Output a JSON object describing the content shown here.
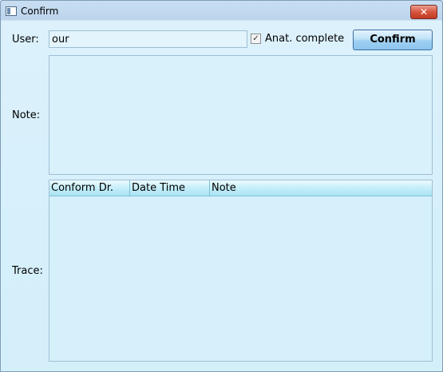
{
  "window": {
    "title": "Confirm",
    "close_glyph": "✕"
  },
  "form": {
    "user_label": "User:",
    "user_value": "our",
    "anat_complete_label": "Anat. complete",
    "anat_complete_checked": true,
    "confirm_button": "Confirm",
    "note_label": "Note:",
    "note_value": "",
    "trace_label": "Trace:"
  },
  "trace": {
    "columns": [
      "Conform Dr.",
      "Date  Time",
      "Note"
    ],
    "rows": []
  },
  "icons": {
    "app": "window-app-icon",
    "close": "close-icon",
    "check": "checkmark-icon"
  }
}
